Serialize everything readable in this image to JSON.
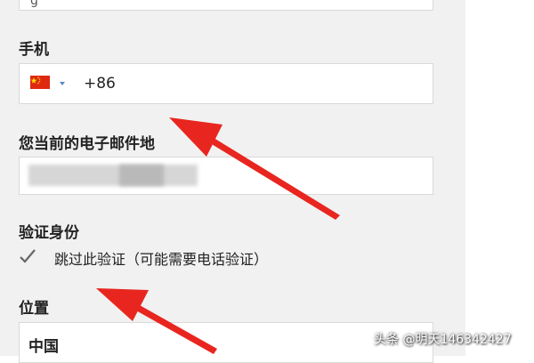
{
  "form": {
    "top_select_partial": "ɡ",
    "phone": {
      "label": "手机",
      "country_code": "+86",
      "flag_icon": "china-flag-icon"
    },
    "email": {
      "label": "您当前的电子邮件地",
      "value_obscured": true
    },
    "verify": {
      "label": "验证身份",
      "checkbox_label": "跳过此验证（可能需要电话验证）",
      "checked": true
    },
    "location": {
      "label": "位置",
      "value": "中国"
    }
  },
  "annotations": {
    "arrow_color": "#e8261f"
  },
  "watermark": "头条 @明天146342427"
}
